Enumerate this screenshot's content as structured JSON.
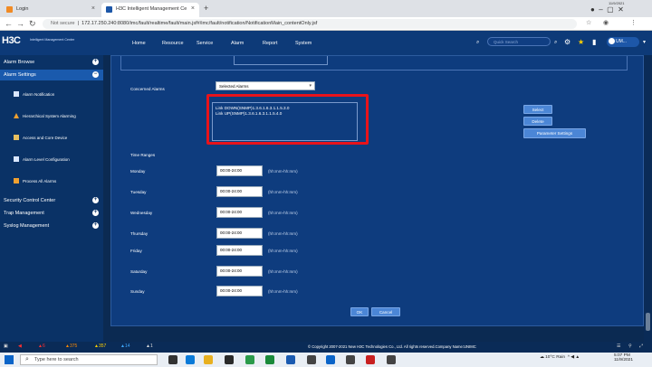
{
  "browser": {
    "tabs": [
      {
        "label": "Login",
        "close": "×"
      },
      {
        "label": "H3C Intelligent Management Ce",
        "close": "×"
      }
    ],
    "new_tab": "+",
    "url_prefix": "Not secure",
    "url": "172.17.250.240:8080/imc/fault/realtime/fault/main.jsf#/imc/fault/notification/NotificationMain_contentOnly.jsf",
    "datetime": "11/9/2021"
  },
  "header": {
    "logo": "H3C",
    "logo_sub": "Intelligent Management Center",
    "menu": [
      "Home",
      "Resource",
      "Service",
      "Alarm",
      "Report",
      "System"
    ],
    "search_placeholder": "Quick Search",
    "user": "UM..."
  },
  "sidebar": {
    "sections": [
      {
        "label": "Alarm Browse",
        "toggle": "+"
      },
      {
        "label": "Alarm Settings",
        "toggle": "−"
      }
    ],
    "items": [
      {
        "label": "Alarm Notification",
        "icon": "notification-icon",
        "color": "#d9e6ff"
      },
      {
        "label": "Hierarchical System Alarming",
        "icon": "warning-icon",
        "color": "#f0a030"
      },
      {
        "label": "Access and Core Device",
        "icon": "device-icon",
        "color": "#e8c060"
      },
      {
        "label": "Alarm Level Configuration",
        "icon": "list-icon",
        "color": "#d9e6ff"
      },
      {
        "label": "Process All Alarms",
        "icon": "process-icon",
        "color": "#f0a030"
      }
    ],
    "lower_sections": [
      {
        "label": "Security Control Center",
        "toggle": "+"
      },
      {
        "label": "Trap Management",
        "toggle": "+"
      },
      {
        "label": "Syslog Management",
        "toggle": "+"
      }
    ]
  },
  "form": {
    "concerned_label": "Concerned Alarms",
    "concerned_select": "Selected Alarms",
    "alarms": [
      "Link DOWN(SNMP)1.3.6.1.6.3.1.1.5.3.0",
      "Link UP(SNMP)1.3.6.1.6.3.1.1.5.4.0"
    ],
    "buttons": [
      "Select",
      "Delete",
      "Parameter Settings"
    ],
    "time_ranges_label": "Time Ranges",
    "days": [
      {
        "day": "Monday",
        "value": "00:00-24:00",
        "hint": "(hh:mm-hh:mm)"
      },
      {
        "day": "Tuesday",
        "value": "00:00-24:00",
        "hint": "(hh:mm-hh:mm)"
      },
      {
        "day": "Wednesday",
        "value": "00:00-24:00",
        "hint": "(hh:mm-hh:mm)"
      },
      {
        "day": "Thursday",
        "value": "00:00-24:00",
        "hint": "(hh:mm-hh:mm)"
      },
      {
        "day": "Friday",
        "value": "00:00-24:00",
        "hint": "(hh:mm-hh:mm)"
      },
      {
        "day": "Saturday",
        "value": "00:00-24:00",
        "hint": "(hh:mm-hh:mm)"
      },
      {
        "day": "Sunday",
        "value": "00:00-24:00",
        "hint": "(hh:mm-hh:mm)"
      }
    ],
    "ok": "OK",
    "cancel": "Cancel"
  },
  "footer": {
    "alarm_counts": [
      {
        "value": "6",
        "color": "#ff3030"
      },
      {
        "value": "375",
        "color": "#ff8a00"
      },
      {
        "value": "357",
        "color": "#ffd000"
      },
      {
        "value": "14",
        "color": "#3fa9ff"
      },
      {
        "value": "1",
        "color": "#dddddd"
      }
    ],
    "copyright": "© Copyright 2007-2021 New H3C Technologies Co., Ltd. All rights reserved.Company Name:UNIMC"
  },
  "taskbar": {
    "search": "Type here to search",
    "weather": "10°C Rain",
    "time": "5:07 PM",
    "date": "11/9/2021"
  }
}
